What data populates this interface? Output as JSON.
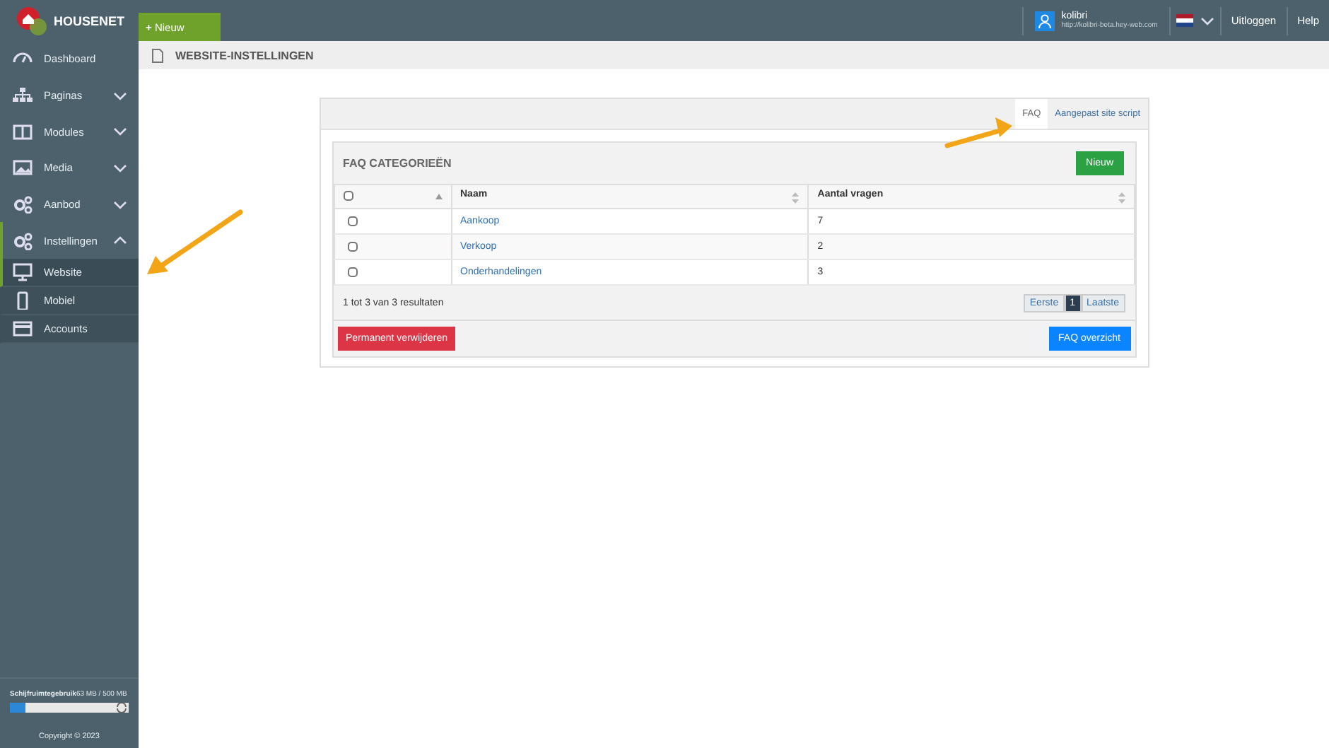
{
  "brand": {
    "name": "HOUSENET"
  },
  "new_button": {
    "icon": "+",
    "label": "Nieuw"
  },
  "user": {
    "name": "kolibri",
    "url": "http://kolibri-beta.hey-web.com"
  },
  "top_links": [
    "Uitloggen",
    "Help"
  ],
  "sidebar": {
    "items": [
      {
        "label": "Dashboard",
        "selected": false
      },
      {
        "label": "Paginas",
        "expanded": false,
        "selected": false
      },
      {
        "label": "Modules",
        "expanded": false,
        "selected": false
      },
      {
        "label": "Media",
        "expanded": false,
        "selected": false
      },
      {
        "label": "Aanbod",
        "expanded": false,
        "selected": false
      },
      {
        "label": "Instellingen",
        "expanded": true,
        "selected": true,
        "children": [
          {
            "label": "Website",
            "selected": true
          },
          {
            "label": "Mobiel",
            "selected": false
          },
          {
            "label": "Accounts",
            "selected": false
          }
        ]
      }
    ]
  },
  "disk": {
    "label": "Schijfruimtegebruik",
    "reading": "63 MB / 500 MB",
    "level": 0.13
  },
  "copyright": "Copyright © 2023",
  "page_title": "WEBSITE-INSTELLINGEN",
  "tabs": [
    {
      "label": "FAQ",
      "selected": true
    },
    {
      "label": "Aangepast site script",
      "selected": false
    }
  ],
  "section": {
    "title": "FAQ CATEGORIEËN",
    "new_label": "Nieuw"
  },
  "table": {
    "all_checked": false,
    "columns": [
      "Naam",
      "Aantal vragen"
    ],
    "rows": [
      {
        "checked": false,
        "cells": [
          "Aankoop",
          "7"
        ]
      },
      {
        "checked": false,
        "cells": [
          "Verkoop",
          "2"
        ]
      },
      {
        "checked": false,
        "cells": [
          "Onderhandelingen",
          "3"
        ]
      }
    ]
  },
  "summary": "1 tot 3 van 3 resultaten",
  "pagination": [
    {
      "label": "Eerste",
      "selected": false
    },
    {
      "label": "1",
      "selected": true
    },
    {
      "label": "Laatste",
      "selected": false
    }
  ],
  "delete_button": "Permanent verwijderen",
  "overview_button": "FAQ overzicht"
}
